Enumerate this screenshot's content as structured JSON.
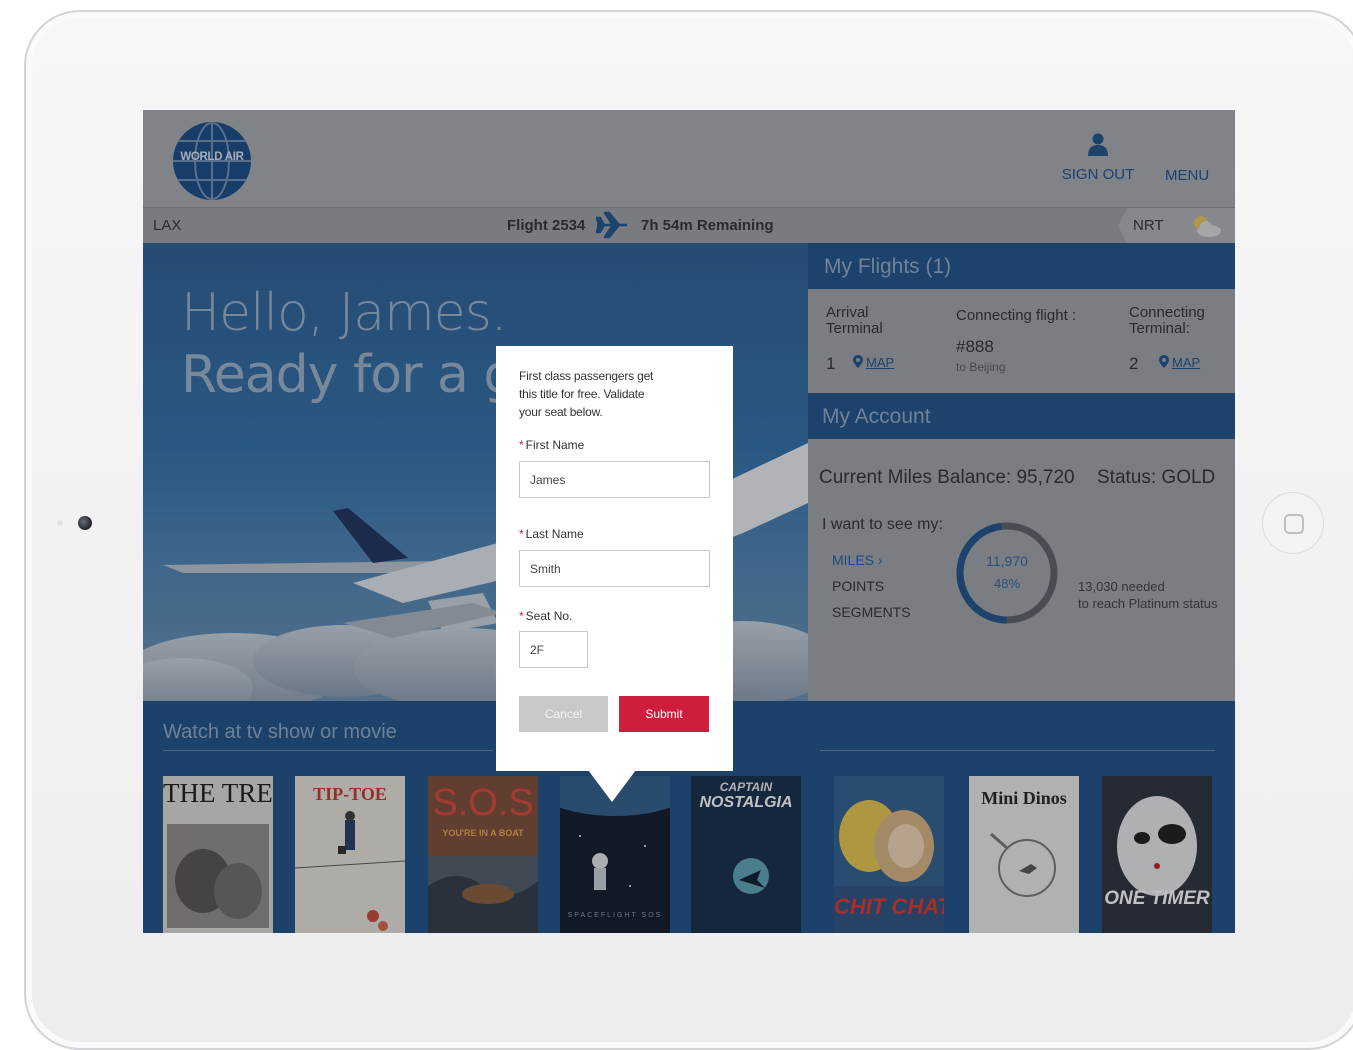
{
  "app": {
    "logo_text": "WORLD AIR"
  },
  "header": {
    "sign_out": "SIGN OUT",
    "menu": "MENU"
  },
  "flight_bar": {
    "origin": "LAX",
    "flight": "Flight 2534",
    "remaining": "7h 54m Remaining",
    "destination": "NRT"
  },
  "hero": {
    "greeting": "Hello, James.",
    "tagline": "Ready for a gre"
  },
  "my_flights": {
    "title": "My Flights (1)",
    "arrival_label": "Arrival Terminal",
    "arrival_number": "1",
    "map_label": "MAP",
    "connecting_flight_label": "Connecting flight :",
    "connecting_flight_number": "#888",
    "connecting_flight_dest": "to Beijing",
    "connecting_terminal_label": "Connecting Terminal:",
    "connecting_terminal_number": "2"
  },
  "my_account": {
    "title": "My Account",
    "miles_balance": "Current Miles Balance: 95,720",
    "status": "Status: GOLD",
    "want_label": "I want to see my:",
    "options": [
      "MILES",
      "POINTS",
      "SEGMENTS"
    ],
    "selected_option": "MILES",
    "ring_value": "11,970",
    "ring_percent_text": "48%",
    "ring_fraction": 0.48,
    "needed_line1": "13,030 needed",
    "needed_line2": "to reach Platinum status"
  },
  "watch": {
    "title": "Watch at tv show or movie",
    "posters": [
      {
        "title": "THE TREK"
      },
      {
        "title": "TIP-TOE"
      },
      {
        "title": "S.O.S",
        "subtitle": "YOU'RE IN A BOAT"
      },
      {
        "title": "SPACEFLIGHT SOS"
      },
      {
        "title": "CAPTAIN",
        "subtitle": "NOSTALGIA"
      },
      {
        "title": "CHIT CHAT"
      },
      {
        "title": "Mini Dinos"
      },
      {
        "title": "ONE TIMER"
      }
    ]
  },
  "modal": {
    "message": "First class passengers get this title for free. Validate your seat below.",
    "first_name_label": "First Name",
    "first_name_value": "James",
    "last_name_label": "Last Name",
    "last_name_value": "Smith",
    "seat_label": "Seat No.",
    "seat_value": "2F",
    "required_mark": "*",
    "cancel": "Cancel",
    "submit": "Submit"
  },
  "colors": {
    "brand_blue": "#1e4f86",
    "submit_red": "#cf1e3c",
    "cancel_gray": "#c7c8ca"
  }
}
